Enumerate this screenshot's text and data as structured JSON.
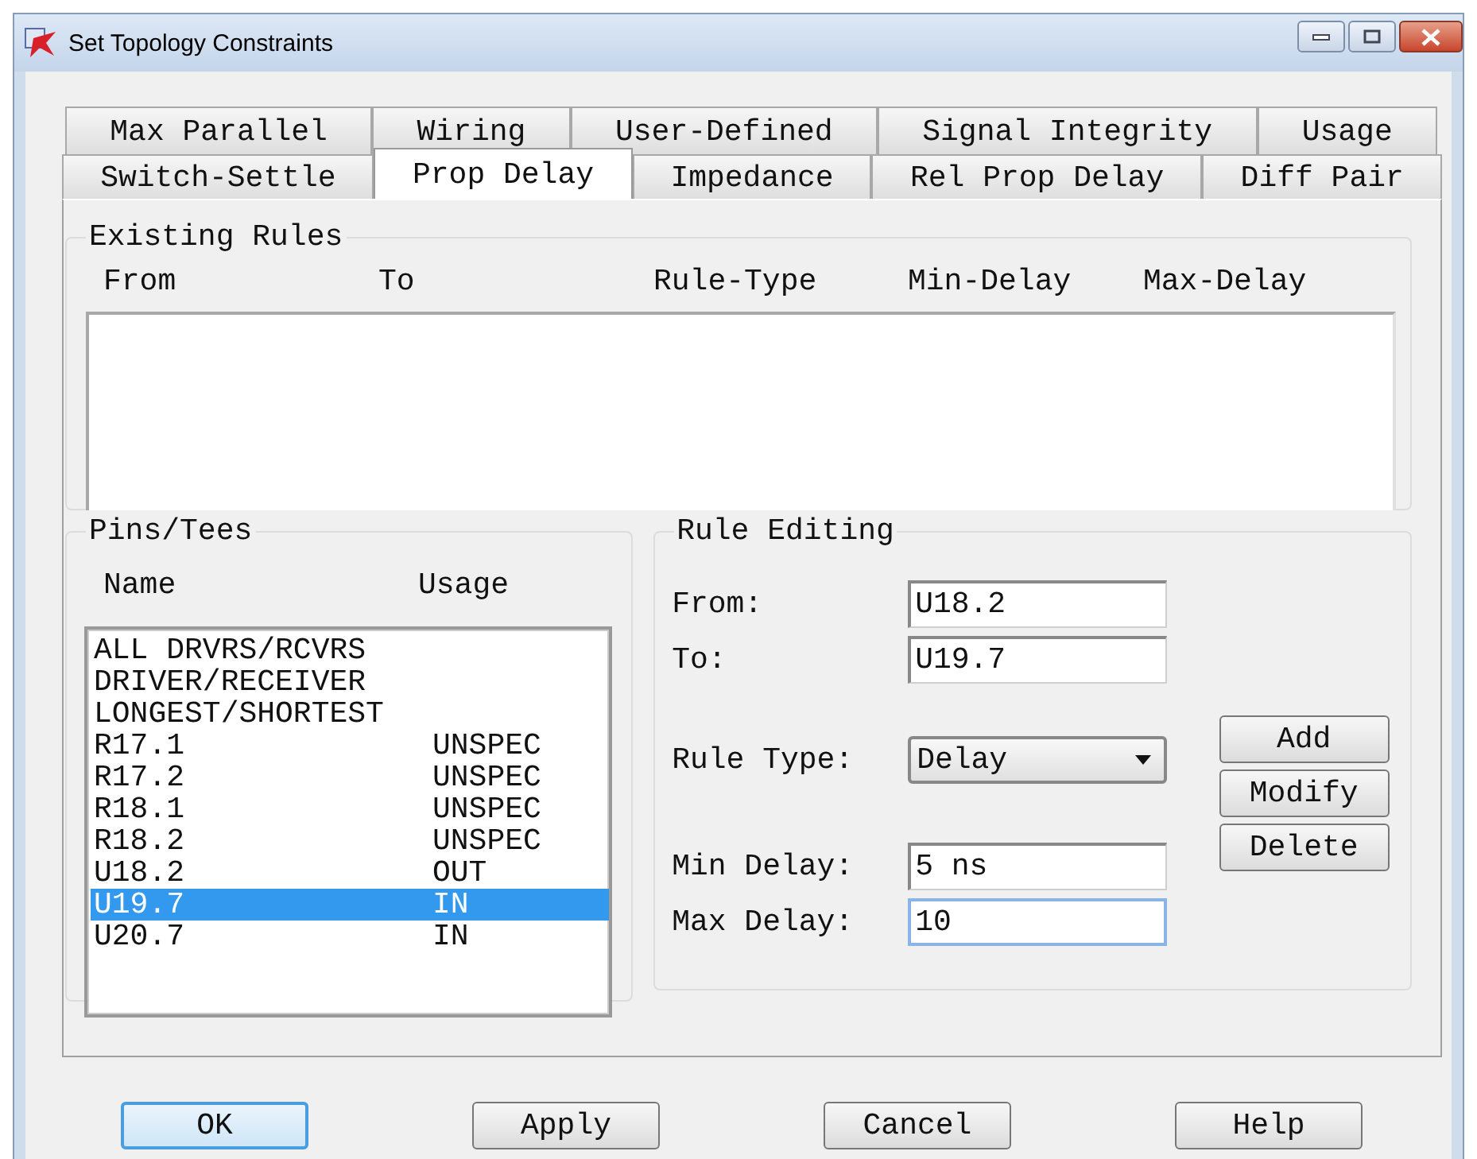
{
  "window": {
    "title": "Set Topology Constraints"
  },
  "tab_rows": [
    [
      {
        "label": "Max Parallel",
        "selected": false
      },
      {
        "label": "Wiring",
        "selected": false
      },
      {
        "label": "User-Defined",
        "selected": false
      },
      {
        "label": "Signal Integrity",
        "selected": false
      },
      {
        "label": "Usage",
        "selected": false
      }
    ],
    [
      {
        "label": "Switch-Settle",
        "selected": false
      },
      {
        "label": "Prop Delay",
        "selected": true
      },
      {
        "label": "Impedance",
        "selected": false
      },
      {
        "label": "Rel Prop Delay",
        "selected": false
      },
      {
        "label": "Diff Pair",
        "selected": false
      }
    ]
  ],
  "existing_rules": {
    "title": "Existing Rules",
    "columns": [
      "From",
      "To",
      "Rule-Type",
      "Min-Delay",
      "Max-Delay"
    ]
  },
  "pins_tees": {
    "title": "Pins/Tees",
    "columns": [
      "Name",
      "Usage"
    ],
    "rows": [
      {
        "name": "ALL DRVRS/RCVRS",
        "selected": false
      },
      {
        "name": "DRIVER/RECEIVER",
        "selected": false
      },
      {
        "name": "LONGEST/SHORTEST",
        "selected": false
      },
      {
        "name": "R17.1",
        "usage": "UNSPEC",
        "selected": false
      },
      {
        "name": "R17.2",
        "usage": "UNSPEC",
        "selected": false
      },
      {
        "name": "R18.1",
        "usage": "UNSPEC",
        "selected": false
      },
      {
        "name": "R18.2",
        "usage": "UNSPEC",
        "selected": false
      },
      {
        "name": "U18.2",
        "usage": "OUT",
        "selected": false
      },
      {
        "name": "U19.7",
        "usage": "IN",
        "selected": true
      },
      {
        "name": "U20.7",
        "usage": "IN",
        "selected": false
      }
    ]
  },
  "rule_editing": {
    "title": "Rule Editing",
    "fields": [
      {
        "kind": "text",
        "label": "From:",
        "value": "U18.2",
        "focused": false
      },
      {
        "kind": "text",
        "label": "To:",
        "value": "U19.7",
        "focused": false
      },
      {
        "kind": "select",
        "label": "Rule Type:",
        "value": "Delay",
        "focused": false
      },
      {
        "kind": "text",
        "label": "Min Delay:",
        "value": "5 ns",
        "focused": false
      },
      {
        "kind": "text",
        "label": "Max Delay:",
        "value": "10",
        "focused": true
      }
    ],
    "buttons": [
      "Add",
      "Modify",
      "Delete"
    ]
  },
  "buttons": [
    {
      "label": "OK",
      "default": true
    },
    {
      "label": "Apply",
      "default": false
    },
    {
      "label": "Cancel",
      "default": false
    },
    {
      "label": "Help",
      "default": false
    }
  ]
}
